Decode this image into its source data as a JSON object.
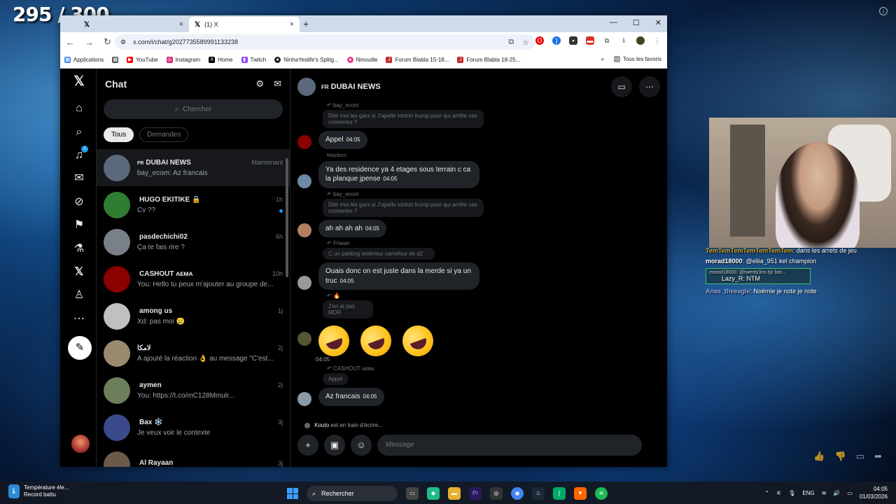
{
  "overlay": {
    "counter": "295 / 300"
  },
  "browser": {
    "tabs": [
      {
        "label": ""
      },
      {
        "label": "(1) X"
      }
    ],
    "url": "x.com/i/chat/g2027735589991133238",
    "bookmarks": [
      {
        "label": "Applications",
        "color": "#4285f4"
      },
      {
        "label": "YouTube",
        "color": "#ff0000"
      },
      {
        "label": "Instagram",
        "color": "#d62976"
      },
      {
        "label": "Home",
        "color": "#000000"
      },
      {
        "label": "Twitch",
        "color": "#9146ff"
      },
      {
        "label": "NinhaYeslife's Splitg...",
        "color": "#222222"
      },
      {
        "label": "Ninouille",
        "color": "#e83e8c"
      },
      {
        "label": "Forum Blabla 15-18...",
        "color": "#c62828"
      },
      {
        "label": "Forum Blabla 18-25...",
        "color": "#c62828"
      }
    ],
    "all_bookmarks": "Tous les favoris"
  },
  "chat": {
    "title": "Chat",
    "search_placeholder": "Chercher",
    "filters": [
      "Tous",
      "Demandes"
    ],
    "conversations": [
      {
        "flag": "FR",
        "name": "DUBAI NEWS",
        "time": "Maintenant",
        "preview": "bay_ecom: Az francais",
        "color": "#5a6a7a"
      },
      {
        "flag": "",
        "name": "HUGO EKITIKE 🔒",
        "time": "1h",
        "preview": "Cv ??",
        "color": "#2e7d32"
      },
      {
        "flag": "",
        "name": "pasdechichi02",
        "time": "6h",
        "preview": "Ça te fais rire ?",
        "color": "#7a8088"
      },
      {
        "flag": "",
        "name": "CASHOUT ᴀᴇᴍᴀ",
        "time": "10h",
        "preview": "You: Hello tu peux m'ajouter au groupe de...",
        "color": "#8b0000"
      },
      {
        "flag": "",
        "name": "among us",
        "time": "1j",
        "preview": "Xd: pas moi 😢",
        "color": "#c0c0c0"
      },
      {
        "flag": "",
        "name": "لامكا",
        "time": "2j",
        "preview": "A ajouté la réaction 👌 au message \"C'est...",
        "color": "#9a8a70"
      },
      {
        "flag": "",
        "name": "aymen",
        "time": "2j",
        "preview": "You: https://t.co/mC128Mmulr...",
        "color": "#6d7f5a"
      },
      {
        "flag": "",
        "name": "Bax ❄️",
        "time": "3j",
        "preview": "Je veux voir le contexte",
        "color": "#3b4a8a"
      },
      {
        "flag": "",
        "name": "Al Rayaan",
        "time": "3j",
        "preview": "",
        "color": "#6a5a4a"
      }
    ]
  },
  "conversation": {
    "group_flag": "FR",
    "group_name": "DUBAI NEWS",
    "messages": [
      {
        "reply_to": "bay_ecom",
        "quote": "Dite moi les gars si J'apelle tonton trump pour qui arrête ces conneries ?"
      },
      {
        "text": "Appel",
        "time": "04:05"
      },
      {
        "sender": "Maydocc"
      },
      {
        "text": "Ya des residence ya 4 etages sous terrain c ca la planque jpense",
        "time": "04:05"
      },
      {
        "reply_to": "bay_ecom",
        "quote": "Dite moi les gars si J'apelle tonton trump pour qui arrête ces conneries ?"
      },
      {
        "text": "ah ah ah ah",
        "time": "04:05"
      },
      {
        "reply_to": "Friwan",
        "quote": "C un parking extérieur carrefour de d2"
      },
      {
        "text": "Ouais donc on est juste dans la merde si ya un truc",
        "time": "04:05"
      },
      {
        "reply_to": "🔥",
        "quote": "J'en ai pas MDR"
      },
      {
        "emoji_time": "04:05"
      },
      {
        "reply_to": "CASHOUT ᴀᴇᴍᴀ",
        "quote": "Appel"
      },
      {
        "text": "Az francais",
        "time": "04:05"
      }
    ],
    "typing_user": "Kouto",
    "typing_text": "est en train d'écrire...",
    "composer_placeholder": "Message"
  },
  "stream_chat": [
    {
      "user": "TemTemTemTemTemTemTem",
      "text": "dans les arrets de jeu"
    },
    {
      "user": "morad18000",
      "text": "@eliia_951 kel champion"
    },
    {
      "user": "morad18000",
      "text": "@twenty3ns bjr fais..."
    },
    {
      "user": "Lazy_R",
      "text": "NTM"
    },
    {
      "user": "Anas_theeagle",
      "text": "Noémie je note je note"
    }
  ],
  "taskbar": {
    "weather_title": "Température éle...",
    "weather_sub": "Record battu",
    "search": "Rechercher",
    "lang": "ENG",
    "time": "04:05",
    "date": "01/03/2026"
  }
}
